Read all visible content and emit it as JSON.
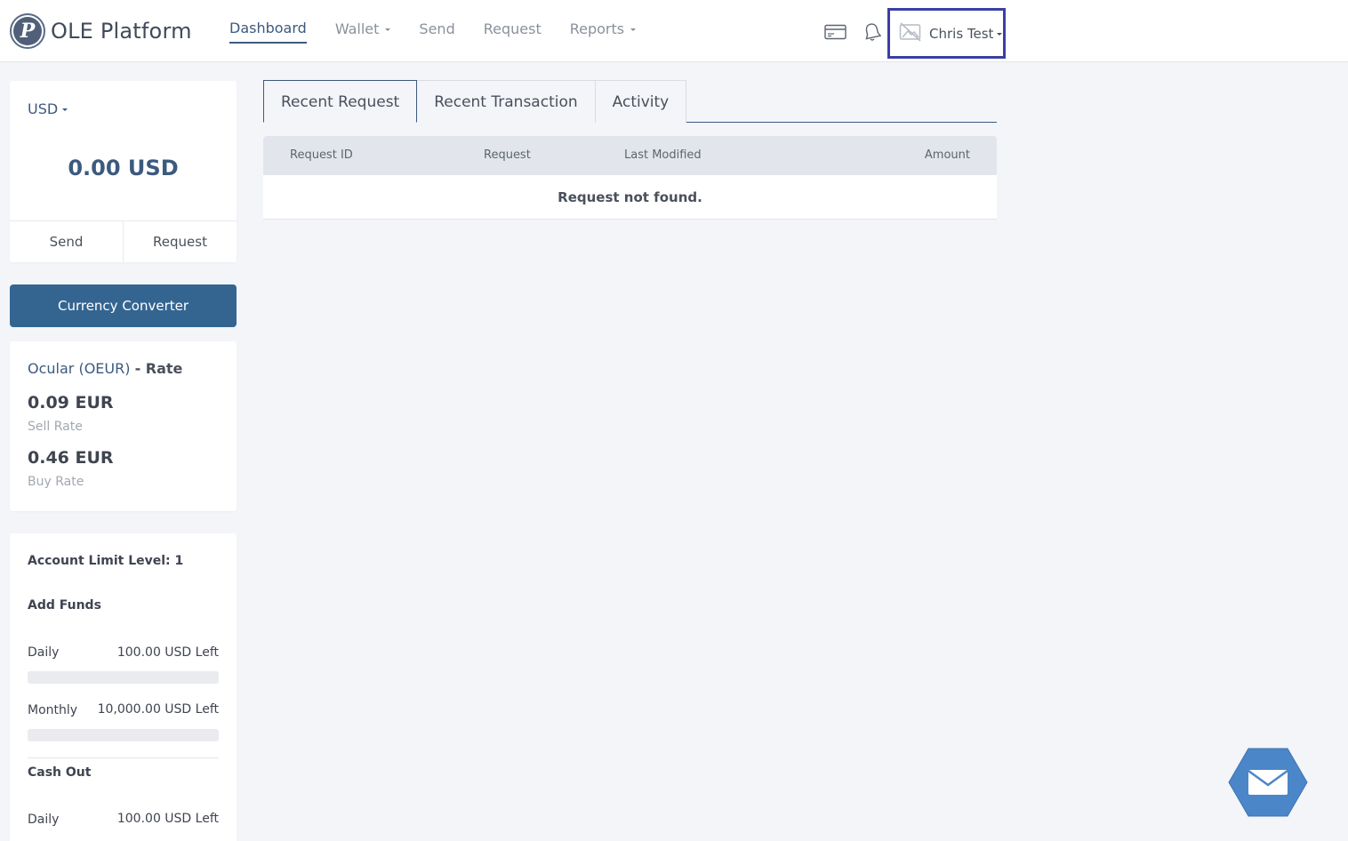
{
  "app": {
    "name": "OLE Platform",
    "logo_letter": "P"
  },
  "nav": {
    "items": [
      {
        "label": "Dashboard",
        "active": true,
        "dropdown": false
      },
      {
        "label": "Wallet",
        "active": false,
        "dropdown": true
      },
      {
        "label": "Send",
        "active": false,
        "dropdown": false
      },
      {
        "label": "Request",
        "active": false,
        "dropdown": false
      },
      {
        "label": "Reports",
        "active": false,
        "dropdown": true
      }
    ]
  },
  "header": {
    "icons": [
      "card-icon",
      "bell-icon",
      "avatar-placeholder-icon"
    ],
    "user_name": "Chris Test"
  },
  "balance": {
    "currency": "USD",
    "amount": "0.00 USD",
    "send_label": "Send",
    "request_label": "Request"
  },
  "converter": {
    "label": "Currency Converter"
  },
  "rate": {
    "currency": "Ocular (OEUR)",
    "title_suffix": "- Rate",
    "sell_value": "0.09 EUR",
    "sell_label": "Sell Rate",
    "buy_value": "0.46 EUR",
    "buy_label": "Buy Rate"
  },
  "limits": {
    "level_label": "Account Limit Level: 1",
    "add_funds": {
      "title": "Add Funds",
      "daily_label": "Daily",
      "daily_left": "100.00 USD Left",
      "daily_used": 0,
      "monthly_label": "Monthly",
      "monthly_left": "10,000.00 USD Left",
      "monthly_used": 0
    },
    "cash_out": {
      "title": "Cash Out",
      "daily_label": "Daily",
      "daily_left": "100.00 USD Left"
    }
  },
  "tabs": [
    {
      "label": "Recent Request",
      "active": true
    },
    {
      "label": "Recent Transaction",
      "active": false
    },
    {
      "label": "Activity",
      "active": false
    }
  ],
  "table": {
    "columns": [
      "Request ID",
      "Request",
      "Last Modified",
      "Amount"
    ],
    "empty_message": "Request not found."
  },
  "colors": {
    "primary": "#346591",
    "accent_text": "#3c5a7e",
    "highlight_border": "#3a3fa6",
    "fab": "#4a86c8"
  }
}
